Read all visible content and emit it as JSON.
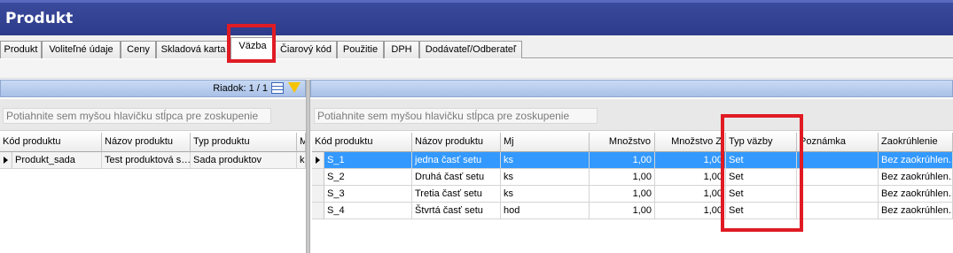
{
  "window": {
    "title": "Produkt"
  },
  "tabs": [
    {
      "label": "Produkt"
    },
    {
      "label": "Voliteľné údaje"
    },
    {
      "label": "Ceny"
    },
    {
      "label": "Skladová karta"
    },
    {
      "label": "Väzba",
      "active": true
    },
    {
      "label": "Čiarový kód"
    },
    {
      "label": "Použitie"
    },
    {
      "label": "DPH"
    },
    {
      "label": "Dodávateľ/Odberateľ"
    }
  ],
  "left_panel": {
    "row_counter": "Riadok: 1 / 1",
    "group_hint": "Potiahnite sem myšou hlavičku stĺpca pre zoskupenie",
    "columns": [
      "Kód produktu",
      "Názov produktu",
      "Typ produktu",
      "M"
    ],
    "rows": [
      [
        "Produkt_sada",
        "Test produktová s…",
        "Sada produktov",
        "k"
      ]
    ]
  },
  "right_panel": {
    "group_hint": "Potiahnite sem myšou hlavičku stĺpca pre zoskupenie",
    "columns": [
      "Kód produktu",
      "Názov produktu",
      "Mj",
      "Množstvo",
      "Množstvo Z",
      "Typ väzby",
      "Poznámka",
      "Zaokrúhlenie"
    ],
    "rows": [
      [
        "S_1",
        "jedna časť setu",
        "ks",
        "1,00",
        "1,00",
        "Set",
        "",
        "Bez zaokrúhlen..."
      ],
      [
        "S_2",
        "Druhá časť setu",
        "ks",
        "1,00",
        "1,00",
        "Set",
        "",
        "Bez zaokrúhlen..."
      ],
      [
        "S_3",
        "Tretia časť setu",
        "ks",
        "1,00",
        "1,00",
        "Set",
        "",
        "Bez zaokrúhlen..."
      ],
      [
        "S_4",
        "Štvrtá časť setu",
        "hod",
        "1,00",
        "1,00",
        "Set",
        "",
        "Bez zaokrúhlen..."
      ]
    ]
  },
  "icons": {
    "grid": "grid-icon",
    "filter": "filter-icon",
    "row_indicator": "row-indicator-arrow-icon"
  },
  "colors": {
    "title_bar": "#2d3b8a",
    "selection": "#3399ff",
    "annotation": "#e01b24"
  }
}
